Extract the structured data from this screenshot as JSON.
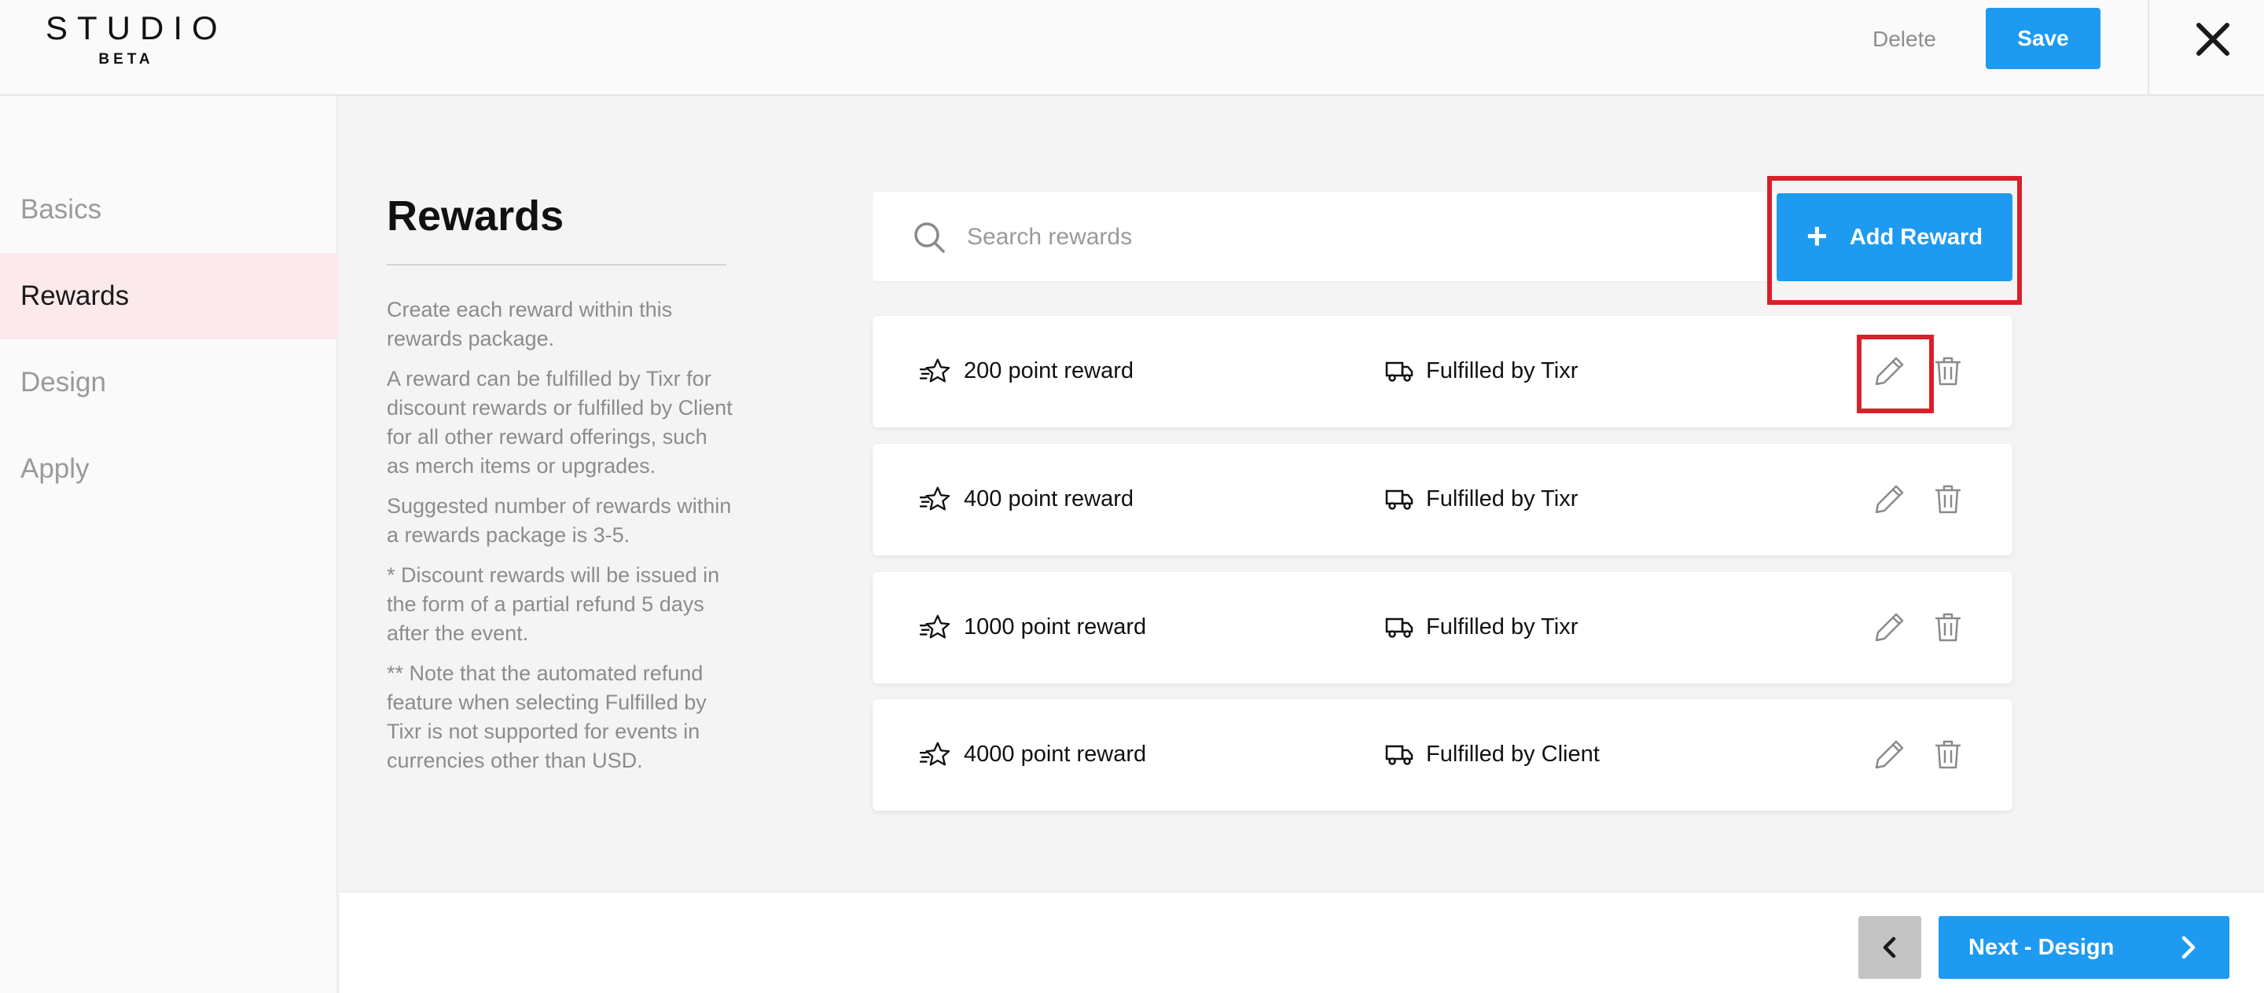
{
  "app": {
    "logo_main": "STUDIO",
    "logo_sub": "BETA"
  },
  "header": {
    "delete_label": "Delete",
    "save_label": "Save",
    "close_icon": "close-icon"
  },
  "sidebar": {
    "items": [
      {
        "label": "Basics",
        "active": false
      },
      {
        "label": "Rewards",
        "active": true
      },
      {
        "label": "Design",
        "active": false
      },
      {
        "label": "Apply",
        "active": false
      }
    ]
  },
  "main": {
    "title": "Rewards",
    "info": [
      "Create each reward within this rewards package.",
      "A reward can be fulfilled by Tixr for discount rewards or fulfilled by Client for all other reward offerings, such as merch items or upgrades.",
      "Suggested number of rewards within a rewards package is 3-5.",
      "* Discount rewards will be issued in the form of a partial refund 5 days after the event.",
      "** Note that the automated refund feature when selecting Fulfilled by Tixr is not supported for events in currencies other than USD."
    ],
    "search": {
      "placeholder": "Search rewards",
      "value": ""
    },
    "add_button": {
      "icon": "plus",
      "label": "Add Reward"
    },
    "rewards": [
      {
        "name": "200 point reward",
        "fulfillment": "Fulfilled by Tixr"
      },
      {
        "name": "400 point reward",
        "fulfillment": "Fulfilled by Tixr"
      },
      {
        "name": "1000 point reward",
        "fulfillment": "Fulfilled by Tixr"
      },
      {
        "name": "4000 point reward",
        "fulfillment": "Fulfilled by Client"
      }
    ]
  },
  "footer": {
    "prev_icon": "chevron-left-icon",
    "next_label": "Next - Design",
    "next_icon": "chevron-right-icon"
  },
  "colors": {
    "primary": "#1e9bf0",
    "highlight": "#d9202a",
    "active_nav_bg": "#fbe9ec",
    "muted_text": "#8c8c8c"
  }
}
